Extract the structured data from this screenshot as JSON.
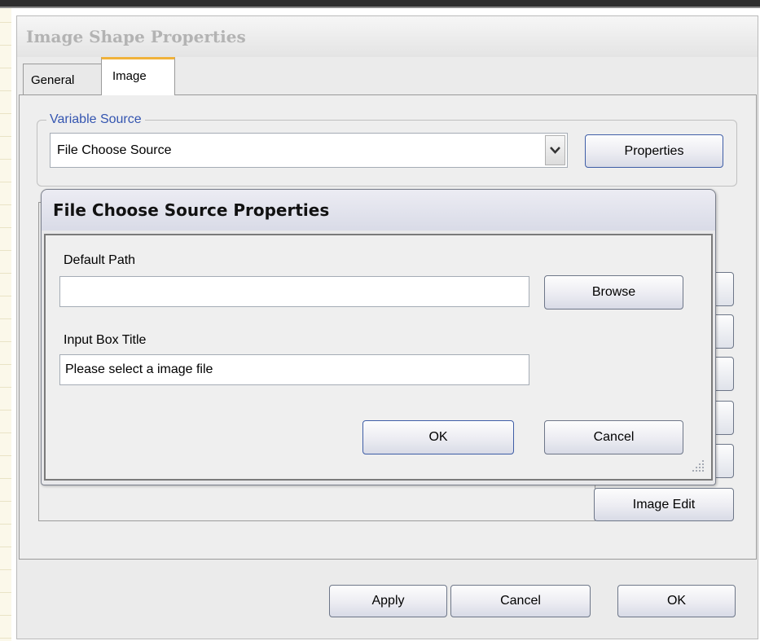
{
  "outer_dialog": {
    "title": "Image Shape Properties",
    "tabs": [
      {
        "label": "General"
      },
      {
        "label": "Image"
      }
    ],
    "variable_source": {
      "legend": "Variable Source",
      "selected": "File Choose Source",
      "properties_label": "Properties"
    },
    "image_edit_label": "Image Edit",
    "footer": {
      "apply_label": "Apply",
      "cancel_label": "Cancel",
      "ok_label": "OK"
    }
  },
  "inner_dialog": {
    "title": "File Choose Source Properties",
    "default_path": {
      "label": "Default Path",
      "value": "",
      "browse_label": "Browse"
    },
    "input_box_title": {
      "label": "Input Box Title",
      "value": "Please select a image file"
    },
    "ok_label": "OK",
    "cancel_label": "Cancel"
  },
  "colors": {
    "accent_tab": "#f0b23a",
    "legend_text": "#3455b0",
    "default_button_border": "#3e5da6"
  }
}
